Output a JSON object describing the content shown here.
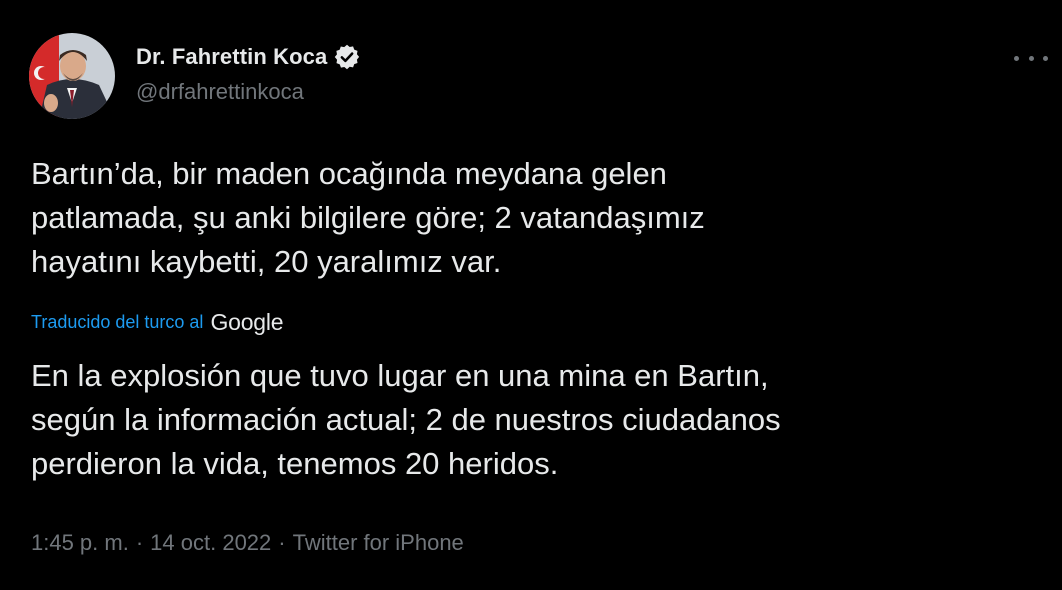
{
  "user": {
    "display_name": "Dr. Fahrettin Koca",
    "handle": "@drfahrettinkoca",
    "verified_icon": "verified-badge-icon",
    "avatar_icon": "avatar-photo"
  },
  "tweet": {
    "original_text": "Bartın’da, bir maden ocağında meydana gelen\npatlamada, şu anki bilgilere göre; 2 vatandaşımız\nhayatını kaybetti, 20 yaralımız var.",
    "translation_label": "Traducido del turco al",
    "translation_provider": "Google",
    "translated_text": "En la explosión que tuvo lugar en una mina en Bartın,\nsegún la información actual; 2 de nuestros ciudadanos\nperdieron la vida, tenemos 20 heridos."
  },
  "meta": {
    "time": "1:45 p. m.",
    "separator": "·",
    "date": "14 oct. 2022",
    "source": "Twitter for iPhone"
  },
  "colors": {
    "background": "#000000",
    "text": "#e7e9ea",
    "secondary": "#71767b",
    "link": "#1d9bf0"
  }
}
